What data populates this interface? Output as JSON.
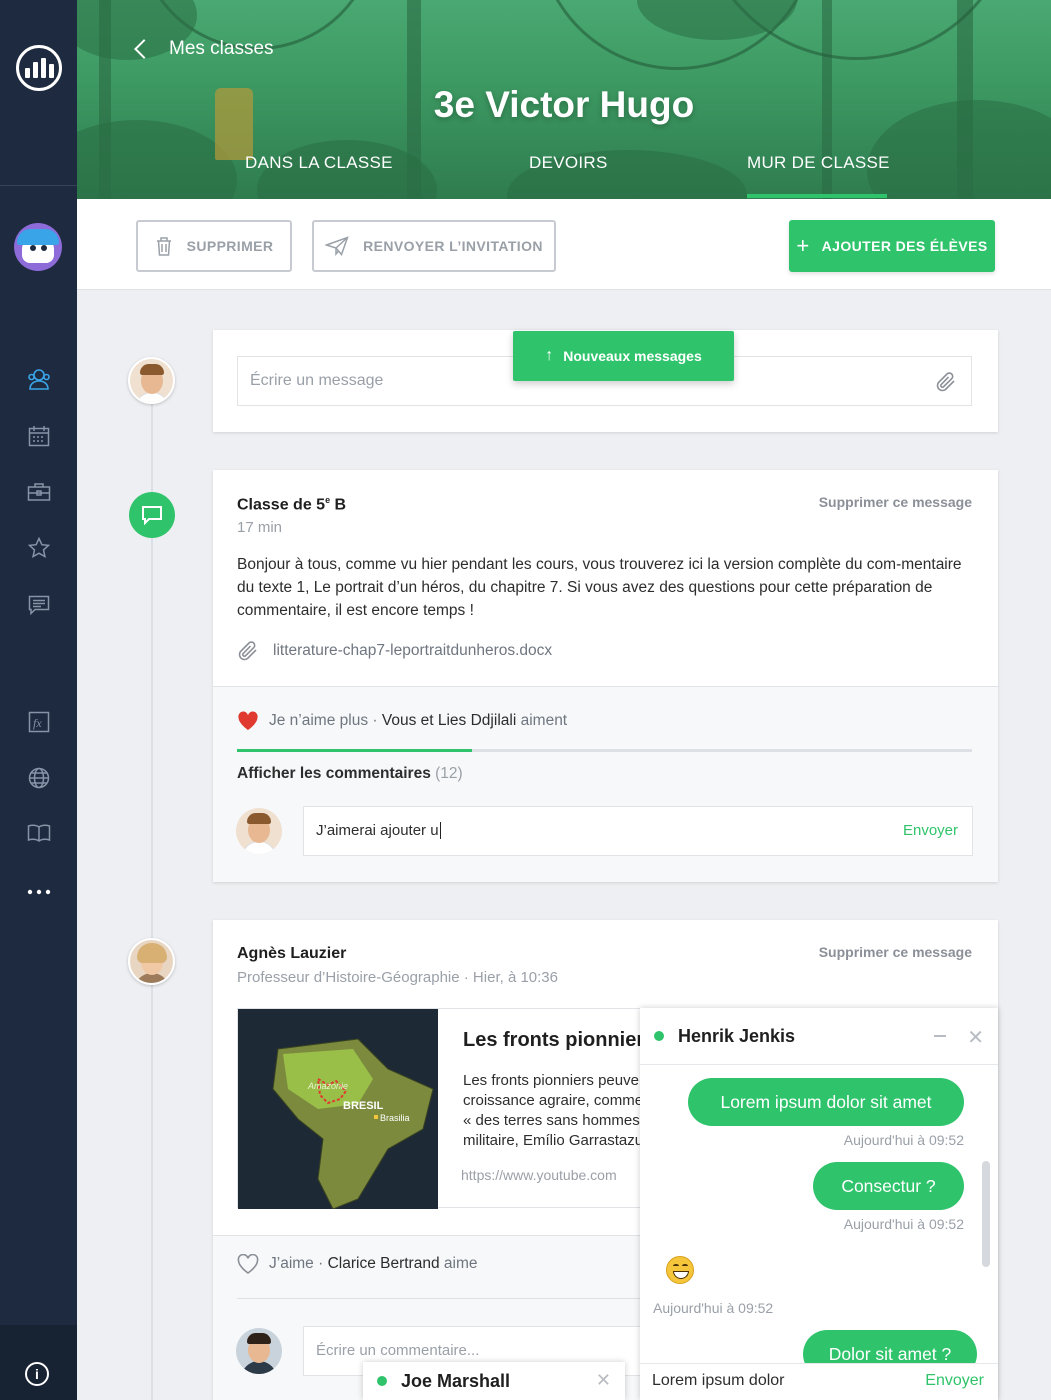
{
  "header": {
    "back_label": "Mes classes",
    "title": "3e Victor Hugo",
    "tabs": [
      {
        "label": "DANS LA CLASSE"
      },
      {
        "label": "DEVOIRS"
      },
      {
        "label": "MUR DE CLASSE",
        "active": true
      }
    ]
  },
  "toolbar": {
    "delete_label": "SUPPRIMER",
    "resend_label": "RENVOYER L’INVITATION",
    "add_label": "AJOUTER DES ÉLÈVES"
  },
  "composer": {
    "placeholder": "Écrire un message",
    "new_messages_label": "Nouveaux messages"
  },
  "posts": [
    {
      "author": "Classe de 5",
      "author_sup": "e",
      "author_suffix": " B",
      "meta": "17 min",
      "delete_label": "Supprimer ce message",
      "body": "Bonjour à tous, comme vu hier pendant les cours, vous trouverez ici la version complète du com-mentaire du texte 1, Le portrait d’un héros, du chapitre 7. Si vous avez des questions pour cette préparation de commentaire, il est encore temps !",
      "attachment": "litterature-chap7-leportraitdunheros.docx",
      "like_action": "Je n’aime plus",
      "like_sep": " · ",
      "like_names": "Vous et Lies Ddjilali",
      "like_verb": "aiment",
      "comments_label": "Afficher les commentaires",
      "comments_count": "(12)",
      "comment_value": "J’aimerai ajouter u",
      "comment_send": "Envoyer"
    },
    {
      "author": "Agnès Lauzier",
      "meta": "Professeur d’Histoire-Géographie · Hier, à 10:36",
      "delete_label": "Supprimer ce message",
      "link_title": "Les fronts pionniers",
      "link_desc": "Les fronts pionniers peuvent se rencontrer dans des pays de forte croissance agraire, comme au Brésil. À partir des années 1970, la politique « des terres sans hommes pour des hommes sans terres » de la dictature militaire, Emílio Garrastazu Médici…",
      "link_url": "https://www.youtube.com",
      "map_labels": [
        "Amazonie",
        "BRESIL",
        "Brasilia"
      ],
      "like_action": "J’aime",
      "like_sep": " · ",
      "like_names": "Clarice Bertrand",
      "like_verb": "aime",
      "comment_placeholder": "Écrire un commentaire..."
    }
  ],
  "chat": {
    "name": "Henrik Jenkis",
    "messages": [
      {
        "text": "Lorem ipsum dolor sit amet",
        "time": "Aujourd'hui à 09:52"
      },
      {
        "text": "Consectur ?",
        "time": "Aujourd'hui à 09:52"
      },
      {
        "text": "",
        "time": "Aujourd'hui à 09:52",
        "emoji": "grinning-face"
      },
      {
        "text": "Dolor sit amet ?"
      }
    ],
    "input_value": "Lorem ipsum dolor",
    "send_label": "Envoyer"
  },
  "chat2": {
    "name": "Joe Marshall"
  },
  "colors": {
    "accent": "#2fc46b",
    "sidebar": "#1e2a3f",
    "header": "#3d9a62",
    "active_icon": "#3aa4e8"
  },
  "sidebar": {
    "icons": [
      "users-icon",
      "calendar-icon",
      "briefcase-icon",
      "star-icon",
      "messages-icon",
      "formula-icon",
      "globe-icon",
      "book-icon",
      "more-icon"
    ],
    "info_label": "i"
  }
}
